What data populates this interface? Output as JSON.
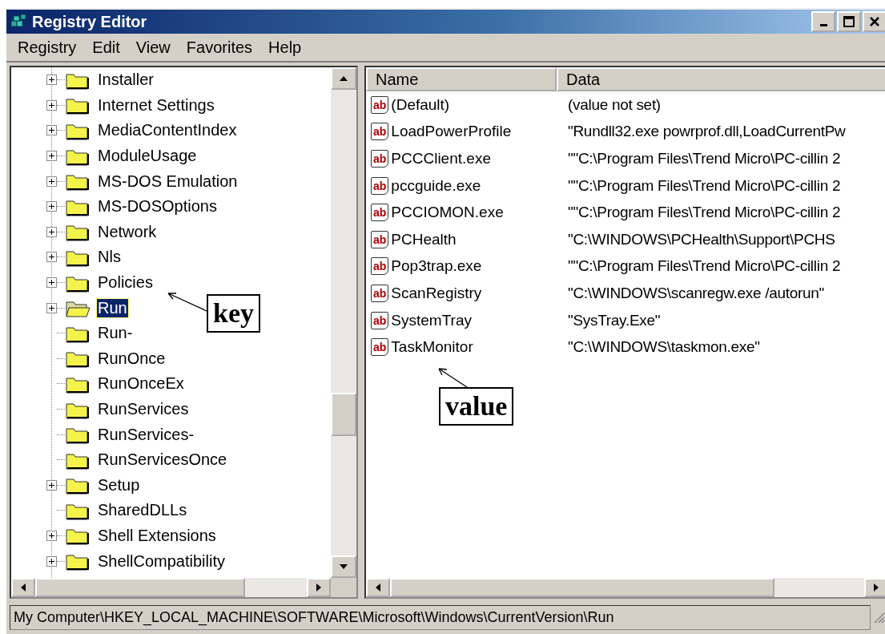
{
  "window": {
    "title": "Registry Editor"
  },
  "menu": [
    "Registry",
    "Edit",
    "View",
    "Favorites",
    "Help"
  ],
  "tree": [
    {
      "label": "Installer",
      "expandable": true,
      "selected": false
    },
    {
      "label": "Internet Settings",
      "expandable": true,
      "selected": false
    },
    {
      "label": "MediaContentIndex",
      "expandable": true,
      "selected": false
    },
    {
      "label": "ModuleUsage",
      "expandable": true,
      "selected": false
    },
    {
      "label": "MS-DOS Emulation",
      "expandable": true,
      "selected": false
    },
    {
      "label": "MS-DOSOptions",
      "expandable": true,
      "selected": false
    },
    {
      "label": "Network",
      "expandable": true,
      "selected": false
    },
    {
      "label": "Nls",
      "expandable": true,
      "selected": false
    },
    {
      "label": "Policies",
      "expandable": true,
      "selected": false
    },
    {
      "label": "Run",
      "expandable": true,
      "selected": true
    },
    {
      "label": "Run-",
      "expandable": false,
      "selected": false
    },
    {
      "label": "RunOnce",
      "expandable": false,
      "selected": false
    },
    {
      "label": "RunOnceEx",
      "expandable": false,
      "selected": false
    },
    {
      "label": "RunServices",
      "expandable": false,
      "selected": false
    },
    {
      "label": "RunServices-",
      "expandable": false,
      "selected": false
    },
    {
      "label": "RunServicesOnce",
      "expandable": false,
      "selected": false
    },
    {
      "label": "Setup",
      "expandable": true,
      "selected": false
    },
    {
      "label": "SharedDLLs",
      "expandable": false,
      "selected": false
    },
    {
      "label": "Shell Extensions",
      "expandable": true,
      "selected": false
    },
    {
      "label": "ShellCompatibility",
      "expandable": true,
      "selected": false
    }
  ],
  "table": {
    "columns": [
      "Name",
      "Data"
    ],
    "rows": [
      {
        "icon_label": "ab",
        "name": "(Default)",
        "data": "(value not set)"
      },
      {
        "icon_label": "ab",
        "name": "LoadPowerProfile",
        "data": "\"Rundll32.exe powrprof.dll,LoadCurrentPw"
      },
      {
        "icon_label": "ab",
        "name": "PCCClient.exe",
        "data": "\"\"C:\\Program Files\\Trend Micro\\PC-cillin 2"
      },
      {
        "icon_label": "ab",
        "name": "pccguide.exe",
        "data": "\"\"C:\\Program Files\\Trend Micro\\PC-cillin 2"
      },
      {
        "icon_label": "ab",
        "name": "PCCIOMON.exe",
        "data": "\"\"C:\\Program Files\\Trend Micro\\PC-cillin 2"
      },
      {
        "icon_label": "ab",
        "name": "PCHealth",
        "data": "\"C:\\WINDOWS\\PCHealth\\Support\\PCHS"
      },
      {
        "icon_label": "ab",
        "name": "Pop3trap.exe",
        "data": "\"\"C:\\Program Files\\Trend Micro\\PC-cillin 2"
      },
      {
        "icon_label": "ab",
        "name": "ScanRegistry",
        "data": "\"C:\\WINDOWS\\scanregw.exe /autorun\""
      },
      {
        "icon_label": "ab",
        "name": "SystemTray",
        "data": "\"SysTray.Exe\""
      },
      {
        "icon_label": "ab",
        "name": "TaskMonitor",
        "data": "\"C:\\WINDOWS\\taskmon.exe\""
      }
    ]
  },
  "annotations": [
    {
      "text": "key"
    },
    {
      "text": "value"
    }
  ],
  "status_bar": "My Computer\\HKEY_LOCAL_MACHINE\\SOFTWARE\\Microsoft\\Windows\\CurrentVersion\\Run"
}
